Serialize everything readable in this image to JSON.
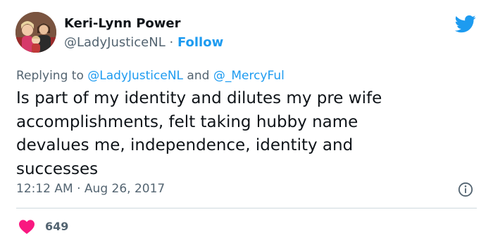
{
  "tweet": {
    "author_name": "Keri-Lynn Power",
    "handle": "@LadyJusticeNL",
    "separator": " · ",
    "follow_label": "Follow",
    "replying_prefix": "Replying to ",
    "reply_mention_1": "@LadyJusticeNL",
    "reply_and": " and ",
    "reply_mention_2": "@_MercyFul",
    "text": "Is part of my identity and dilutes my pre wife\naccomplishments, felt taking hubby name\ndevalues me, independence,  identity and\nsuccesses",
    "time": "12:12 AM",
    "date_separator": " · ",
    "date": "Aug 26, 2017",
    "like_count": "649"
  },
  "icons": {
    "brand": "twitter-bird-icon",
    "info": "info-icon",
    "like": "heart-icon"
  },
  "colors": {
    "accent": "#1d9bf0",
    "like": "#f91880",
    "secondary_text": "#536471"
  }
}
